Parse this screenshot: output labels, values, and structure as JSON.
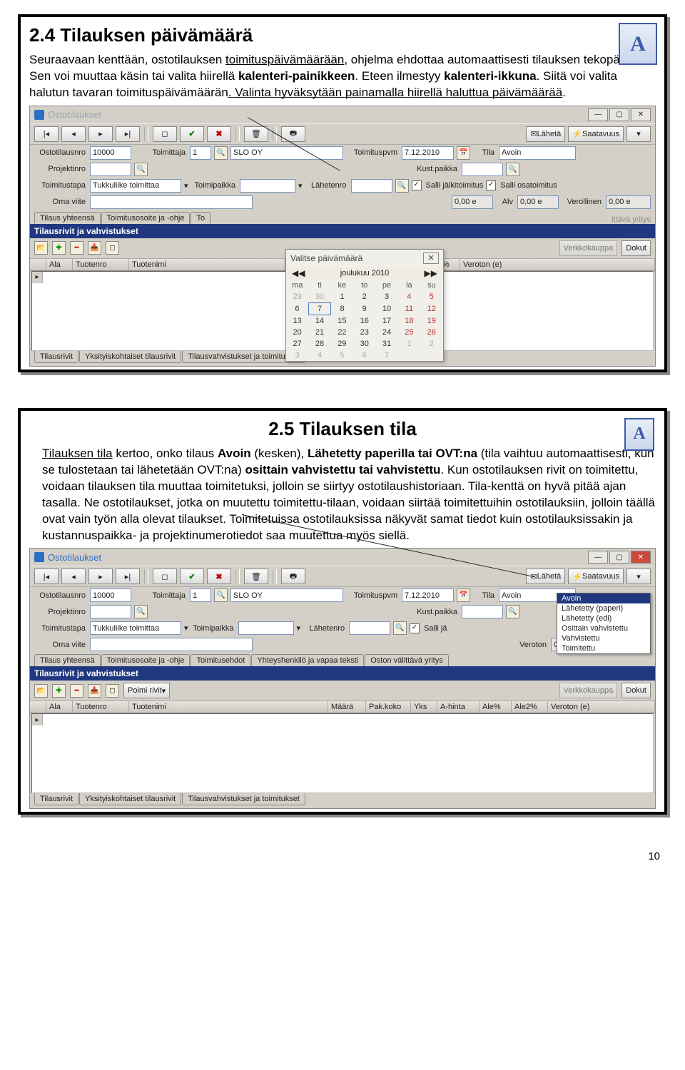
{
  "page_number": "10",
  "logo_letter": "A",
  "section1": {
    "heading": "2.4 Tilauksen päivämäärä",
    "para": {
      "t1": "Seuraavaan kenttään, ostotilauksen ",
      "u1": "toimituspäivämäärään",
      "t2": ", ohjelma ehdottaa automaattisesti tilauksen tekopäivää. Sen voi muuttaa käsin tai valita hiirellä ",
      "b1": "kalenteri-painikkeen",
      "t3": ". Eteen ilmestyy ",
      "b2": "kalenteri-ikkuna",
      "t4": ". Siitä voi valita halutun tavaran toimituspäivämäärän. Valinta hyväksytään painamalla hiirellä haluttua ",
      "u2": "päivämäärää",
      "t5": "."
    }
  },
  "section2": {
    "heading": "2.5 Tilauksen tila",
    "para": {
      "t1": "Tilauksen tila",
      "t2": " kertoo, onko tilaus ",
      "b1": "Avoin",
      "t3": " (kesken), ",
      "b2": "Lähetetty paperilla tai OVT:na",
      "t4": " (tila vaihtuu automaattisesti, kun se tulostetaan tai lähetetään OVT:na) ",
      "b3": "osittain vahvistettu tai vahvistettu",
      "t5": ". Kun ostotilauksen rivit on toimitettu, voidaan tilauksen tila muuttaa toimitetuksi, jolloin se siirtyy ostotilaushistoriaan. Tila-kenttä on hyvä pitää ajan tasalla. Ne ostotilaukset, jotka on muutettu toimitettu-tilaan, voidaan siirtää toimitettuihin ostotilauksiin, jolloin täällä ovat vain työn alla olevat tilaukset. Toimitetuissa ostotilauksissa näkyvät samat tiedot kuin ostotilauksissakin ja kustannuspaikka- ja projektinumerotiedot saa muutettua myös siellä."
    }
  },
  "win": {
    "title": "Ostotilaukset",
    "toolbar": {
      "laheta": "Lähetä",
      "saatavuus": "Saatavuus"
    },
    "labels": {
      "ostotilausnro": "Ostotilausnro",
      "toimittaja": "Toimittaja",
      "toimituspvm": "Toimituspvm",
      "tila": "Tila",
      "projektinro": "Projektinro",
      "kust": "Kust.paikka",
      "toimitustapa": "Toimitustapa",
      "toimipaikka": "Toimipaikka",
      "laheteno": "Lähetenro",
      "salli1": "Salli jälkitoimitus",
      "salli2": "Salli osatoimitus",
      "omaviite": "Oma viite",
      "alv": "Alv",
      "verollinen": "Verollinen",
      "veroton": "Veroton",
      "tilausrivit": "Tilausrivit ja vahvistukset",
      "poimi": "Poimi rivit",
      "verkkokauppa": "Verkkokauppa",
      "dokut": "Dokut"
    },
    "values": {
      "ostotilausnro": "10000",
      "toimittaja_num": "1",
      "toimittaja_name": "SLO OY",
      "toimituspvm": "7.12.2010",
      "tila": "Avoin",
      "toimitustapa": "Tukkuliike toimittaa",
      "alv00": "0,00 e",
      "alv": "0,00 e",
      "verollinen": "0,00 e",
      "alv_short": "0,00"
    },
    "tabs_mid": [
      "Tilaus yhteensä",
      "Toimitusosoite ja -ohje",
      "Toimitusehdot",
      "Yhteyshenkilö ja vapaa teksti",
      "Oston välittävä yritys"
    ],
    "tabs_mid_short": [
      "Tilaus yhteensä",
      "Toimitusosoite ja -ohje",
      "To"
    ],
    "cols": [
      "Ala",
      "Tuotenro",
      "Tuotenimi",
      "Määrä",
      "Pak.koko",
      "Yks",
      "A-hinta",
      "Ale%",
      "Ale2%",
      "Veroton (e)"
    ],
    "cols_short": [
      "Ala",
      "Tuotenro",
      "Tuotenimi",
      "k.koko",
      "Yks",
      "A-hinta",
      "Ale%",
      "Ale2%",
      "Veroton (e)"
    ],
    "tabs_bottom": [
      "Tilausrivit",
      "Yksityiskohtaiset tilausrivit",
      "Tilausvahvistukset ja toimitukset"
    ]
  },
  "calendar": {
    "popup_title": "Valitse päivämäärä",
    "month": "joulukuu 2010",
    "dow": [
      "ma",
      "ti",
      "ke",
      "to",
      "pe",
      "la",
      "su"
    ],
    "weeks": [
      [
        {
          "n": "29",
          "c": "outside"
        },
        {
          "n": "30",
          "c": "outside"
        },
        {
          "n": "1"
        },
        {
          "n": "2"
        },
        {
          "n": "3"
        },
        {
          "n": "4",
          "c": "weekend"
        },
        {
          "n": "5",
          "c": "weekend"
        }
      ],
      [
        {
          "n": "6"
        },
        {
          "n": "7",
          "c": "sel"
        },
        {
          "n": "8"
        },
        {
          "n": "9"
        },
        {
          "n": "10"
        },
        {
          "n": "11",
          "c": "weekend"
        },
        {
          "n": "12",
          "c": "weekend"
        }
      ],
      [
        {
          "n": "13"
        },
        {
          "n": "14"
        },
        {
          "n": "15"
        },
        {
          "n": "16"
        },
        {
          "n": "17"
        },
        {
          "n": "18",
          "c": "weekend"
        },
        {
          "n": "19",
          "c": "weekend"
        }
      ],
      [
        {
          "n": "20"
        },
        {
          "n": "21"
        },
        {
          "n": "22"
        },
        {
          "n": "23"
        },
        {
          "n": "24"
        },
        {
          "n": "25",
          "c": "weekend"
        },
        {
          "n": "26",
          "c": "weekend"
        }
      ],
      [
        {
          "n": "27"
        },
        {
          "n": "28"
        },
        {
          "n": "29"
        },
        {
          "n": "30"
        },
        {
          "n": "31"
        },
        {
          "n": "1",
          "c": "outside"
        },
        {
          "n": "2",
          "c": "outside"
        }
      ],
      [
        {
          "n": "3",
          "c": "outside"
        },
        {
          "n": "4",
          "c": "outside"
        },
        {
          "n": "5",
          "c": "outside"
        },
        {
          "n": "6",
          "c": "outside"
        },
        {
          "n": "7",
          "c": "outside"
        },
        {
          "n": "",
          "c": ""
        },
        {
          "n": "",
          "c": ""
        }
      ]
    ]
  },
  "dropdown": {
    "items": [
      "Avoin",
      "Lähetetty (paperi)",
      "Lähetetty (edi)",
      "Osittain vahvistettu",
      "Vahvistettu",
      "Toimitettu"
    ]
  }
}
